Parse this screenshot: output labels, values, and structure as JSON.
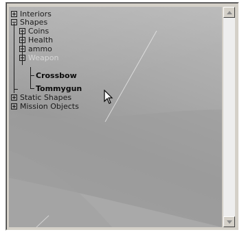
{
  "tree": {
    "items": [
      {
        "label": "Interiors",
        "expander": "plus-icon"
      },
      {
        "label": "Shapes",
        "expander": "minus-icon"
      },
      {
        "label": "Coins",
        "expander": "plus-icon"
      },
      {
        "label": "Health",
        "expander": "plus-icon"
      },
      {
        "label": "ammo",
        "expander": "plus-icon"
      },
      {
        "label": "Weapon",
        "expander": "minus-icon"
      },
      {
        "label": "Crossbow"
      },
      {
        "label": "Tommygun"
      },
      {
        "label": "Static Shapes",
        "expander": "plus-icon"
      },
      {
        "label": "Mission Objects",
        "expander": "plus-icon"
      }
    ]
  },
  "scrollbar": {
    "up_icon": "arrow-up-icon",
    "down_icon": "arrow-down-icon"
  },
  "cursor": {
    "icon": "mouse-pointer-icon"
  },
  "colors": {
    "tree_background": "#a8a8a8",
    "tree_text": "#1a1a1a",
    "faded_text": "#d6d6d6",
    "panel": "#d4d0c8"
  }
}
